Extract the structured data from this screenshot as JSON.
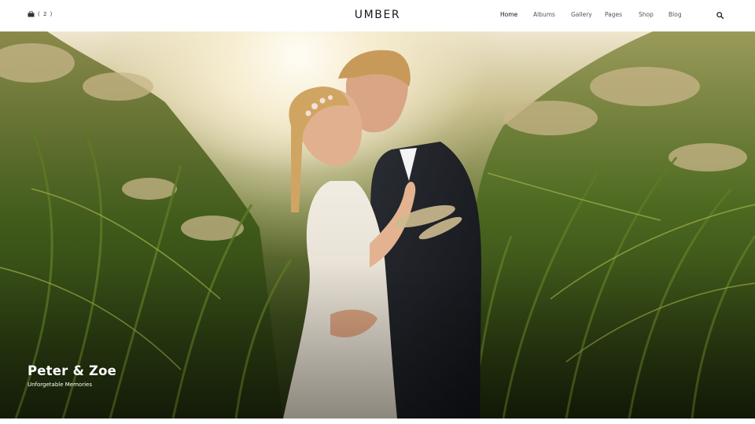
{
  "header": {
    "cart_count": "( 2 )",
    "logo": "UMBER",
    "nav": {
      "home": "Home",
      "albums": "Albums",
      "gallery": "Gallery",
      "pages": "Pages",
      "shop": "Shop",
      "blog": "Blog"
    },
    "active_nav": "Home"
  },
  "hero": {
    "title": "Peter & Zoe",
    "subtitle": "Unforgetable Memories"
  },
  "icons": {
    "cart": "shopping-bag-icon",
    "search": "search-icon"
  },
  "colors": {
    "text_dark": "#111111",
    "nav_text": "#555555",
    "caption": "#ffffff"
  }
}
